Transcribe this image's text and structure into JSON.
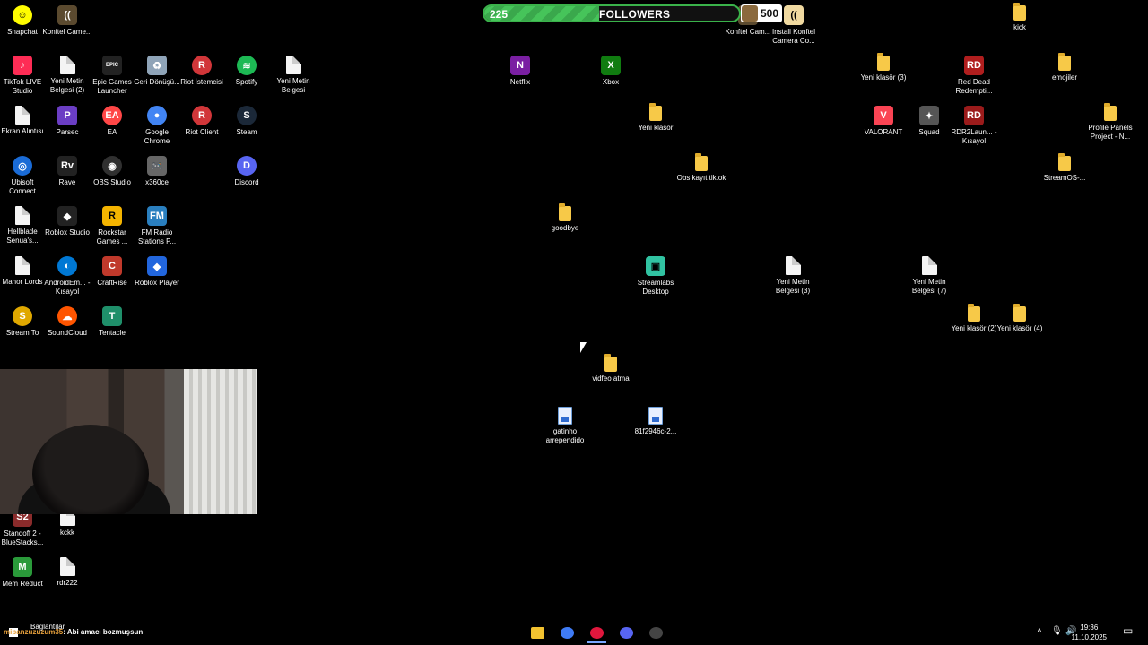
{
  "followers": {
    "current": "225",
    "title": "FOLLOWERS",
    "goal": "500",
    "progress_fraction": 0.45
  },
  "desktop_icons": [
    {
      "label": "Snapchat",
      "icon": "snapchat-icon",
      "color": "#fffc00",
      "fg": "#000",
      "glyph": "☺",
      "shape": "round"
    },
    {
      "label": "Konftel Came...",
      "icon": "konftel-icon",
      "color": "#5b4a2f",
      "glyph": "((",
      "shape": ""
    },
    {
      "label": "TikTok LIVE Studio",
      "icon": "tiktok-icon",
      "color": "#fe2c55",
      "glyph": "♪",
      "shape": ""
    },
    {
      "label": "Yeni Metin Belgesi (2)",
      "icon": "text-file-icon",
      "shape": "doc"
    },
    {
      "label": "Epic Games Launcher",
      "icon": "epic-games-icon",
      "color": "#222",
      "glyph": "EPIC",
      "shape": ""
    },
    {
      "label": "Geri Dönüşü...",
      "icon": "recycle-bin-icon",
      "color": "#8fa4b8",
      "glyph": "♻",
      "shape": ""
    },
    {
      "label": "Riot İstemcisi",
      "icon": "riot-icon",
      "color": "#d13639",
      "glyph": "R",
      "shape": "round"
    },
    {
      "label": "Spotify",
      "icon": "spotify-icon",
      "color": "#1db954",
      "glyph": "≋",
      "shape": "round"
    },
    {
      "label": "Yeni Metin Belgesi",
      "icon": "text-file-icon",
      "shape": "doc"
    },
    {
      "label": "Ekran Alıntısı",
      "icon": "text-file-icon",
      "shape": "doc"
    },
    {
      "label": "Parsec",
      "icon": "parsec-icon",
      "color": "#6b3ec4",
      "glyph": "P",
      "shape": ""
    },
    {
      "label": "EA",
      "icon": "ea-icon",
      "color": "#ff4747",
      "glyph": "EA",
      "shape": "round"
    },
    {
      "label": "Google Chrome",
      "icon": "chrome-icon",
      "color": "#4285f4",
      "glyph": "●",
      "shape": "round"
    },
    {
      "label": "Riot Client",
      "icon": "riot-icon",
      "color": "#d13639",
      "glyph": "R",
      "shape": "round"
    },
    {
      "label": "Steam",
      "icon": "steam-icon",
      "color": "#1b2838",
      "glyph": "S",
      "shape": "round"
    },
    {
      "label": "Ubisoft Connect",
      "icon": "ubisoft-icon",
      "color": "#1a6bd6",
      "glyph": "◎",
      "shape": "round"
    },
    {
      "label": "Rave",
      "icon": "rave-icon",
      "color": "#222",
      "glyph": "Rv",
      "shape": ""
    },
    {
      "label": "OBS Studio",
      "icon": "obs-icon",
      "color": "#303030",
      "glyph": "◉",
      "shape": "round"
    },
    {
      "label": "x360ce",
      "icon": "gamepad-icon",
      "color": "#666",
      "glyph": "🎮",
      "shape": ""
    },
    {
      "label": "Discord",
      "icon": "discord-icon",
      "color": "#5865f2",
      "glyph": "D",
      "shape": "round"
    },
    {
      "label": "Hellblade Senua's...",
      "icon": "text-file-icon",
      "shape": "doc"
    },
    {
      "label": "Roblox Studio",
      "icon": "roblox-icon",
      "color": "#222",
      "glyph": "◆",
      "shape": ""
    },
    {
      "label": "Rockstar Games ...",
      "icon": "rockstar-icon",
      "color": "#f4b400",
      "fg": "#000",
      "glyph": "R",
      "shape": ""
    },
    {
      "label": "FM Radio Stations P...",
      "icon": "radio-icon",
      "color": "#2a7fbf",
      "glyph": "FM",
      "shape": ""
    },
    {
      "label": "Manor Lords",
      "icon": "text-file-icon",
      "shape": "doc"
    },
    {
      "label": "AndroidEm... - Kısayol",
      "icon": "android-emulator-icon",
      "color": "#0078d4",
      "glyph": "◐",
      "shape": "round"
    },
    {
      "label": "CraftRise",
      "icon": "craftrise-icon",
      "color": "#c0392b",
      "glyph": "C",
      "shape": ""
    },
    {
      "label": "Roblox Player",
      "icon": "roblox-icon",
      "color": "#2266dd",
      "glyph": "◆",
      "shape": ""
    },
    {
      "label": "Stream To",
      "icon": "stream-tool-icon",
      "color": "#e0a800",
      "glyph": "S",
      "shape": "round"
    },
    {
      "label": "SoundCloud",
      "icon": "soundcloud-icon",
      "color": "#ff5500",
      "glyph": "☁",
      "shape": "round"
    },
    {
      "label": "Tentacle",
      "icon": "tentacle-icon",
      "color": "#1f8f6a",
      "glyph": "T",
      "shape": ""
    },
    {
      "label": "Standoff 2 - BlueStacks...",
      "icon": "standoff-icon",
      "color": "#8a2b2b",
      "glyph": "S2",
      "shape": ""
    },
    {
      "label": "kckk",
      "icon": "text-file-icon",
      "shape": "doc"
    },
    {
      "label": "Mem Reduct",
      "icon": "mem-reduct-icon",
      "color": "#2a9a3a",
      "glyph": "M",
      "shape": ""
    },
    {
      "label": "rdr222",
      "icon": "text-file-icon",
      "shape": "doc"
    },
    {
      "label": "Netflix",
      "icon": "netflix-icon",
      "color": "#7a1fa2",
      "glyph": "N",
      "shape": ""
    },
    {
      "label": "Xbox",
      "icon": "xbox-icon",
      "color": "#107c10",
      "glyph": "X",
      "shape": ""
    },
    {
      "label": "Yeni klasör",
      "icon": "folder-icon",
      "shape": "folder"
    },
    {
      "label": "Obs kayıt tiktok",
      "icon": "folder-icon",
      "shape": "folder"
    },
    {
      "label": "goodbye",
      "icon": "folder-icon",
      "shape": "folder"
    },
    {
      "label": "Streamlabs Desktop",
      "icon": "streamlabs-icon",
      "color": "#31c3a2",
      "fg": "#000",
      "glyph": "▣",
      "shape": ""
    },
    {
      "label": "vidfeo atma",
      "icon": "folder-icon",
      "shape": "folder"
    },
    {
      "label": "gatinho arrependido",
      "icon": "image-file-icon",
      "shape": "img"
    },
    {
      "label": "81f2946c-2...",
      "icon": "image-file-icon",
      "shape": "img"
    },
    {
      "label": "Konftel Cam...",
      "icon": "konftel-icon",
      "color": "#5b4a2f",
      "glyph": "((",
      "shape": ""
    },
    {
      "label": "Install Konftel Camera Co...",
      "icon": "konftel-icon",
      "color": "#f0d9a0",
      "fg": "#000",
      "glyph": "((",
      "shape": ""
    },
    {
      "label": "Yeni klasör (3)",
      "icon": "folder-icon",
      "shape": "folder"
    },
    {
      "label": "Red Dead Redempti...",
      "icon": "red-dead-icon",
      "color": "#b01e1e",
      "glyph": "RD",
      "shape": ""
    },
    {
      "label": "VALORANT",
      "icon": "valorant-icon",
      "color": "#fa4454",
      "glyph": "V",
      "shape": ""
    },
    {
      "label": "Squad",
      "icon": "squad-icon",
      "color": "#555",
      "glyph": "✦",
      "shape": ""
    },
    {
      "label": "RDR2Laun... - Kısayol",
      "icon": "red-dead-icon",
      "color": "#9b1b1b",
      "glyph": "RD",
      "shape": ""
    },
    {
      "label": "Yeni Metin Belgesi (3)",
      "icon": "text-file-icon",
      "shape": "doc"
    },
    {
      "label": "Yeni Metin Belgesi (7)",
      "icon": "text-file-icon",
      "shape": "doc"
    },
    {
      "label": "kick",
      "icon": "folder-icon",
      "shape": "folder"
    },
    {
      "label": "emojiler",
      "icon": "folder-icon",
      "shape": "folder"
    },
    {
      "label": "Profile Panels Project - N...",
      "icon": "folder-icon",
      "shape": "folder"
    },
    {
      "label": "StreamOS-...",
      "icon": "folder-icon",
      "shape": "folder"
    },
    {
      "label": "Yeni klasör (2)",
      "icon": "folder-icon",
      "shape": "folder"
    },
    {
      "label": "Yeni klasör (4)",
      "icon": "folder-icon",
      "shape": "folder"
    }
  ],
  "taskbar": {
    "search_label": "Bağlantılar",
    "chat_user": "mipanzuzuzum35",
    "chat_message": ": Abi amacı bozmuşsun",
    "apps": [
      {
        "icon": "file-explorer-icon",
        "color": "#f2c230"
      },
      {
        "icon": "copilot-icon",
        "color": "#3f7bf5"
      },
      {
        "icon": "opera-gx-icon",
        "color": "#e0173d"
      },
      {
        "icon": "discord-icon",
        "color": "#5865f2"
      },
      {
        "icon": "obs-icon",
        "color": "#444"
      }
    ],
    "time": "19:36",
    "date": "11.10.2025"
  }
}
